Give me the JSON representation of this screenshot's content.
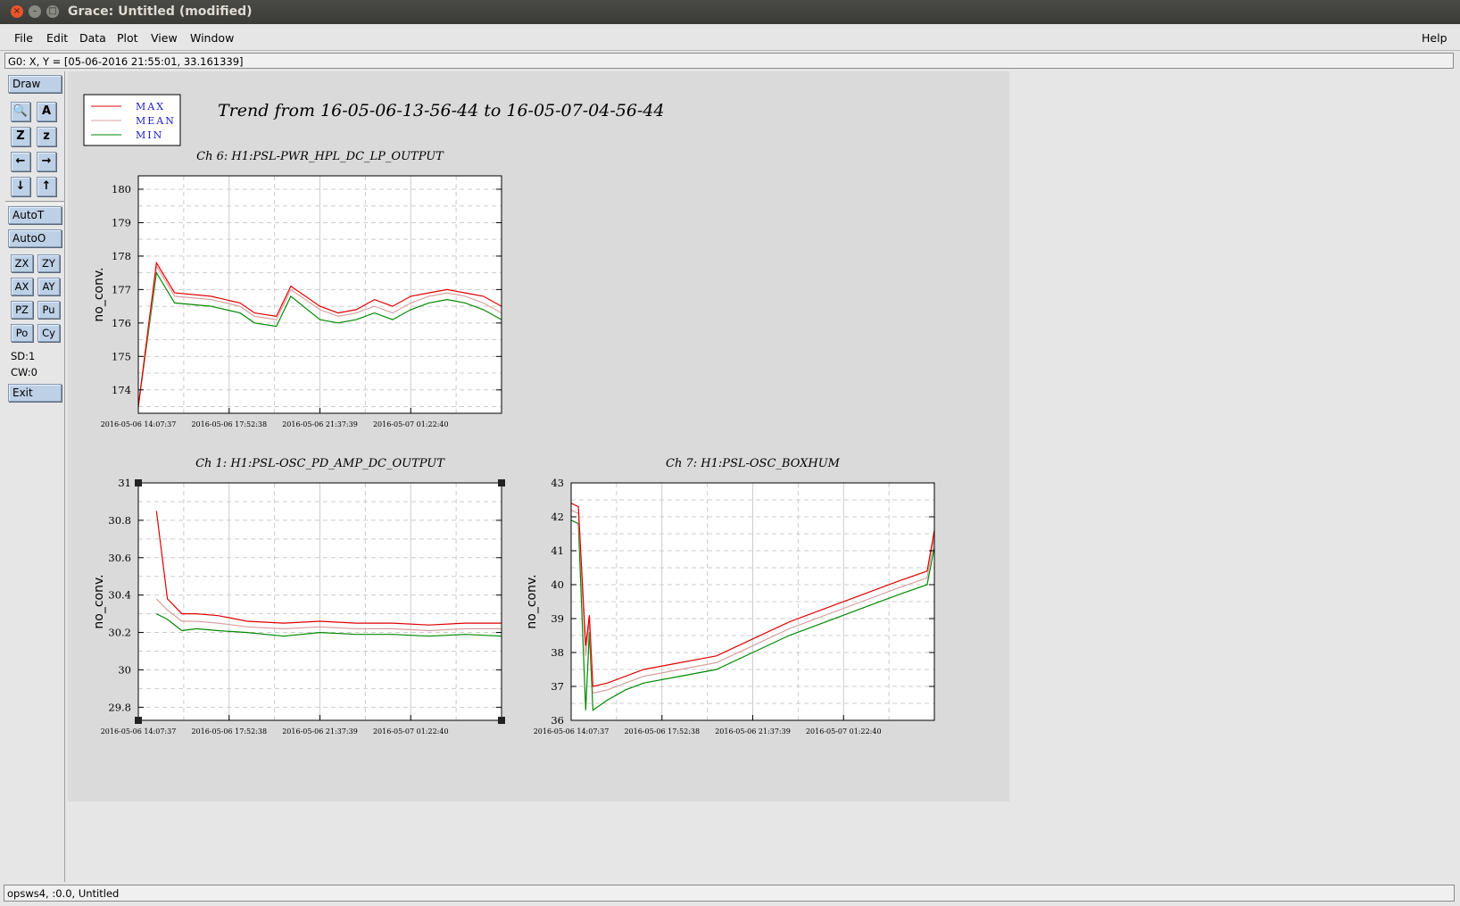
{
  "window": {
    "title": "Grace: Untitled (modified)",
    "controls": {
      "close": "×",
      "minimize": "–",
      "maximize": "□"
    }
  },
  "menubar": {
    "items": [
      {
        "label": "File"
      },
      {
        "label": "Edit"
      },
      {
        "label": "Data"
      },
      {
        "label": "Plot"
      },
      {
        "label": "View"
      },
      {
        "label": "Window"
      }
    ],
    "help": "Help"
  },
  "coordinate_readout": "G0: X, Y = [05-06-2016 21:55:01, 33.161339]",
  "toolbar": {
    "draw": "Draw",
    "icon_buttons": [
      {
        "name": "zoom-icon",
        "glyph": "🔍"
      },
      {
        "name": "text-tool-icon",
        "glyph": "A"
      },
      {
        "name": "zoom-in-icon",
        "glyph": "Z"
      },
      {
        "name": "zoom-out-icon",
        "glyph": "z"
      },
      {
        "name": "arrow-left-icon",
        "glyph": "←"
      },
      {
        "name": "arrow-right-icon",
        "glyph": "→"
      },
      {
        "name": "arrow-down-icon",
        "glyph": "↓"
      },
      {
        "name": "arrow-up-icon",
        "glyph": "↑"
      }
    ],
    "autot": "AutoT",
    "autoo": "AutoO",
    "small_buttons": [
      "ZX",
      "ZY",
      "AX",
      "AY",
      "PZ",
      "Pu",
      "Po",
      "Cy"
    ],
    "sd": "SD:1",
    "cw": "CW:0",
    "exit": "Exit"
  },
  "canvas": {
    "main_title": "Trend from 16-05-06-13-56-44 to 16-05-07-04-56-44",
    "legend": [
      {
        "label": "MAX",
        "color": "#e00000"
      },
      {
        "label": "MEAN",
        "color": "#d8a0a0"
      },
      {
        "label": "MIN",
        "color": "#008800"
      }
    ],
    "legend_text_color": "#1a1acc"
  },
  "status_bar": "opsws4, :0.0, Untitled",
  "chart_data": [
    {
      "type": "line",
      "title": "Ch 6: H1:PSL-PWR_HPL_DC_LP_OUTPUT",
      "xlabel": "",
      "ylabel": "no_conv.",
      "x_tick_labels": [
        "2016-05-06 14:07:37",
        "2016-05-06 17:52:38",
        "2016-05-06 21:37:39",
        "2016-05-07 01:22:40"
      ],
      "y_ticks": [
        174,
        175,
        176,
        177,
        178,
        179,
        180
      ],
      "ylim": [
        173.3,
        180.4
      ],
      "grid": true,
      "selected": false,
      "series": [
        {
          "name": "MAX",
          "x": [
            0,
            0.05,
            0.1,
            0.2,
            0.28,
            0.32,
            0.38,
            0.42,
            0.5,
            0.55,
            0.6,
            0.65,
            0.7,
            0.75,
            0.8,
            0.85,
            0.9,
            0.95,
            1.0
          ],
          "values": [
            173.5,
            177.8,
            176.9,
            176.8,
            176.6,
            176.3,
            176.2,
            177.1,
            176.5,
            176.3,
            176.4,
            176.7,
            176.5,
            176.8,
            176.9,
            177.0,
            176.9,
            176.8,
            176.5
          ]
        },
        {
          "name": "MEAN",
          "x": [
            0,
            0.05,
            0.1,
            0.2,
            0.28,
            0.32,
            0.38,
            0.42,
            0.5,
            0.55,
            0.6,
            0.65,
            0.7,
            0.75,
            0.8,
            0.85,
            0.9,
            0.95,
            1.0
          ],
          "values": [
            173.5,
            177.7,
            176.8,
            176.7,
            176.5,
            176.2,
            176.1,
            177.0,
            176.4,
            176.2,
            176.3,
            176.5,
            176.3,
            176.6,
            176.8,
            176.9,
            176.8,
            176.6,
            176.3
          ]
        },
        {
          "name": "MIN",
          "x": [
            0,
            0.05,
            0.1,
            0.2,
            0.28,
            0.32,
            0.38,
            0.42,
            0.5,
            0.55,
            0.6,
            0.65,
            0.7,
            0.75,
            0.8,
            0.85,
            0.9,
            0.95,
            1.0
          ],
          "values": [
            173.5,
            177.5,
            176.6,
            176.5,
            176.3,
            176.0,
            175.9,
            176.8,
            176.1,
            176.0,
            176.1,
            176.3,
            176.1,
            176.4,
            176.6,
            176.7,
            176.6,
            176.4,
            176.1
          ]
        }
      ]
    },
    {
      "type": "line",
      "title": "Ch 1: H1:PSL-OSC_PD_AMP_DC_OUTPUT",
      "xlabel": "",
      "ylabel": "no_conv.",
      "x_tick_labels": [
        "2016-05-06 14:07:37",
        "2016-05-06 17:52:38",
        "2016-05-06 21:37:39",
        "2016-05-07 01:22:40"
      ],
      "y_ticks": [
        29.8,
        30,
        30.2,
        30.4,
        30.6,
        30.8,
        31
      ],
      "ylim": [
        29.73,
        31.0
      ],
      "grid": true,
      "selected": true,
      "series": [
        {
          "name": "MAX",
          "x": [
            0.05,
            0.08,
            0.12,
            0.16,
            0.22,
            0.3,
            0.4,
            0.5,
            0.6,
            0.7,
            0.8,
            0.9,
            1.0
          ],
          "values": [
            30.85,
            30.38,
            30.3,
            30.3,
            30.29,
            30.26,
            30.25,
            30.26,
            30.25,
            30.25,
            30.24,
            30.25,
            30.25
          ]
        },
        {
          "name": "MEAN",
          "x": [
            0.05,
            0.08,
            0.12,
            0.16,
            0.22,
            0.3,
            0.4,
            0.5,
            0.6,
            0.7,
            0.8,
            0.9,
            1.0
          ],
          "values": [
            30.38,
            30.32,
            30.26,
            30.26,
            30.25,
            30.23,
            30.22,
            30.23,
            30.22,
            30.22,
            30.21,
            30.22,
            30.22
          ]
        },
        {
          "name": "MIN",
          "x": [
            0.05,
            0.08,
            0.12,
            0.16,
            0.22,
            0.3,
            0.4,
            0.5,
            0.6,
            0.7,
            0.8,
            0.9,
            1.0
          ],
          "values": [
            30.3,
            30.27,
            30.21,
            30.22,
            30.21,
            30.2,
            30.18,
            30.2,
            30.19,
            30.19,
            30.18,
            30.19,
            30.18
          ]
        }
      ]
    },
    {
      "type": "line",
      "title": "Ch 7: H1:PSL-OSC_BOXHUM",
      "xlabel": "",
      "ylabel": "no_conv.",
      "x_tick_labels": [
        "2016-05-06 14:07:37",
        "2016-05-06 17:52:38",
        "2016-05-06 21:37:39",
        "2016-05-07 01:22:40"
      ],
      "y_ticks": [
        36,
        37,
        38,
        39,
        40,
        41,
        42,
        43
      ],
      "ylim": [
        36.0,
        43.0
      ],
      "grid": true,
      "selected": false,
      "series": [
        {
          "name": "MAX",
          "x": [
            0,
            0.02,
            0.04,
            0.05,
            0.06,
            0.1,
            0.15,
            0.2,
            0.3,
            0.4,
            0.5,
            0.6,
            0.7,
            0.8,
            0.9,
            0.98,
            1.0
          ],
          "values": [
            42.4,
            42.3,
            38.2,
            39.1,
            37.0,
            37.1,
            37.3,
            37.5,
            37.7,
            37.9,
            38.4,
            38.9,
            39.3,
            39.7,
            40.1,
            40.4,
            41.6
          ]
        },
        {
          "name": "MEAN",
          "x": [
            0,
            0.02,
            0.04,
            0.05,
            0.06,
            0.1,
            0.15,
            0.2,
            0.3,
            0.4,
            0.5,
            0.6,
            0.7,
            0.8,
            0.9,
            0.98,
            1.0
          ],
          "values": [
            42.2,
            42.1,
            37.9,
            38.9,
            36.8,
            36.9,
            37.1,
            37.3,
            37.5,
            37.7,
            38.2,
            38.7,
            39.1,
            39.5,
            39.9,
            40.2,
            41.4
          ]
        },
        {
          "name": "MIN",
          "x": [
            0,
            0.02,
            0.04,
            0.05,
            0.06,
            0.1,
            0.15,
            0.2,
            0.3,
            0.4,
            0.5,
            0.6,
            0.7,
            0.8,
            0.9,
            0.98,
            1.0
          ],
          "values": [
            41.9,
            41.8,
            36.3,
            38.6,
            36.3,
            36.6,
            36.9,
            37.1,
            37.3,
            37.5,
            38.0,
            38.5,
            38.9,
            39.3,
            39.7,
            40.0,
            41.1
          ]
        }
      ]
    }
  ]
}
